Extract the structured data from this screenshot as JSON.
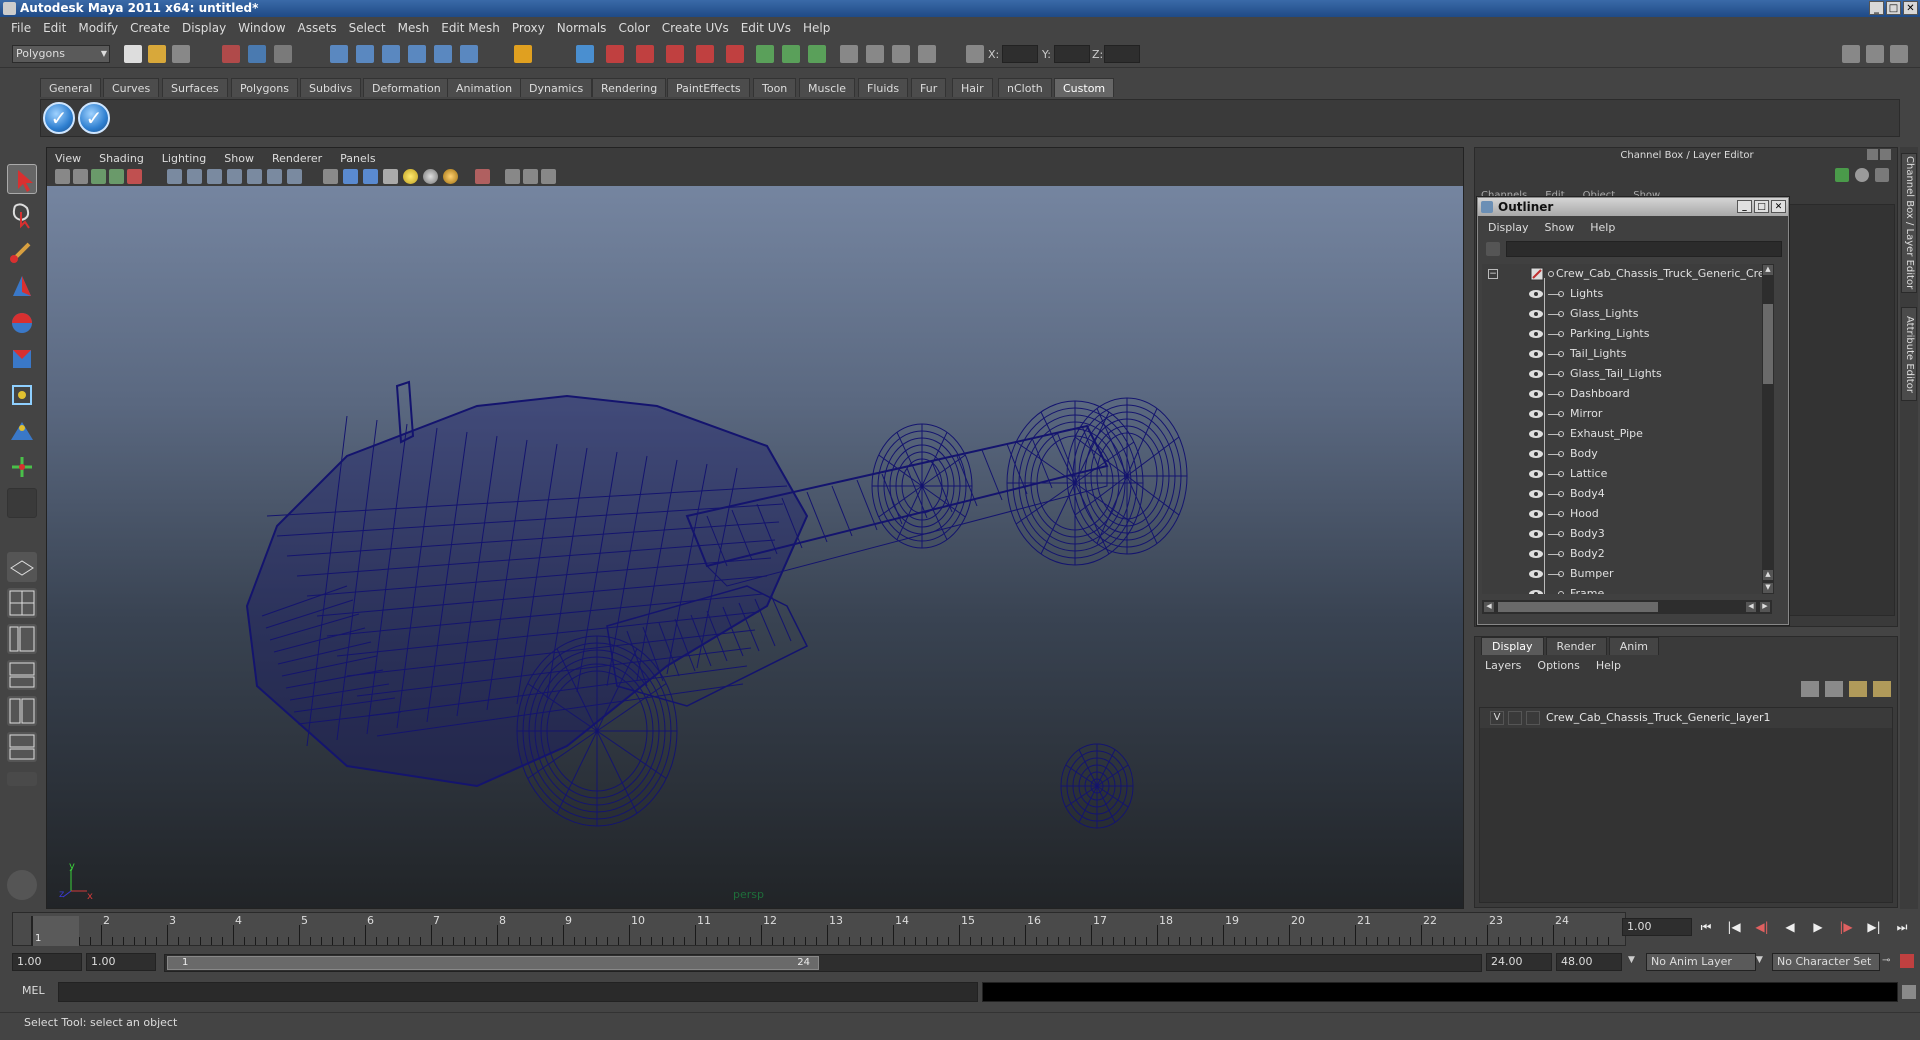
{
  "window": {
    "title": "Autodesk Maya 2011 x64: untitled*"
  },
  "menubar": [
    "File",
    "Edit",
    "Modify",
    "Create",
    "Display",
    "Window",
    "Assets",
    "Select",
    "Mesh",
    "Edit Mesh",
    "Proxy",
    "Normals",
    "Color",
    "Create UVs",
    "Edit UVs",
    "Help"
  ],
  "statusline": {
    "mode": "Polygons",
    "x_label": "X:",
    "y_label": "Y:",
    "z_label": "Z:"
  },
  "shelf": {
    "tabs": [
      "General",
      "Curves",
      "Surfaces",
      "Polygons",
      "Subdivs",
      "Deformation",
      "Animation",
      "Dynamics",
      "Rendering",
      "PaintEffects",
      "Toon",
      "Muscle",
      "Fluids",
      "Fur",
      "Hair",
      "nCloth",
      "Custom"
    ],
    "active_tab": "Custom",
    "buttons": [
      "check-icon",
      "check-icon"
    ]
  },
  "viewport": {
    "menu": [
      "View",
      "Shading",
      "Lighting",
      "Show",
      "Renderer",
      "Panels"
    ],
    "camera_label": "persp",
    "axis": {
      "y": "y",
      "x": "x",
      "z": "z"
    },
    "wire_color": "#14146e"
  },
  "channel_box": {
    "title": "Channel Box / Layer Editor",
    "menu": [
      "Channels",
      "Edit",
      "Object",
      "Show"
    ]
  },
  "outliner": {
    "title": "Outliner",
    "menu": [
      "Display",
      "Show",
      "Help"
    ],
    "root": "Crew_Cab_Chassis_Truck_Generic_Crew_Ca",
    "items": [
      "Lights",
      "Glass_Lights",
      "Parking_Lights",
      "Tail_Lights",
      "Glass_Tail_Lights",
      "Dashboard",
      "Mirror",
      "Exhaust_Pipe",
      "Body",
      "Lattice",
      "Body4",
      "Hood",
      "Body3",
      "Body2",
      "Bumper",
      "Frame"
    ]
  },
  "layer_editor": {
    "tabs": [
      "Display",
      "Render",
      "Anim"
    ],
    "active_tab": "Display",
    "menu": [
      "Layers",
      "Options",
      "Help"
    ],
    "layers": [
      {
        "visible": "V",
        "name": "Crew_Cab_Chassis_Truck_Generic_layer1"
      }
    ]
  },
  "side_tabs": [
    "Channel Box / Layer Editor",
    "Attribute Editor"
  ],
  "time_slider": {
    "ticks": [
      "1",
      "2",
      "3",
      "4",
      "5",
      "6",
      "7",
      "8",
      "9",
      "10",
      "11",
      "12",
      "13",
      "14",
      "15",
      "16",
      "17",
      "18",
      "19",
      "20",
      "21",
      "22",
      "23",
      "24"
    ],
    "current_marker": "1",
    "current_frame": "1.00",
    "playback_buttons": [
      "go-to-start-icon",
      "step-back-key-icon",
      "step-back-icon",
      "play-back-icon",
      "play-forward-icon",
      "step-forward-key-icon",
      "step-forward-icon",
      "go-to-end-icon"
    ]
  },
  "range_slider": {
    "start_time": "1.00",
    "playback_start": "1.00",
    "range_start_label": "1",
    "range_end_label": "24",
    "playback_end": "24.00",
    "end_time": "48.00",
    "anim_layer": "No Anim Layer",
    "character_set": "No Character Set"
  },
  "command_line": {
    "label": "MEL"
  },
  "help_line": {
    "text": "Select Tool: select an object"
  }
}
